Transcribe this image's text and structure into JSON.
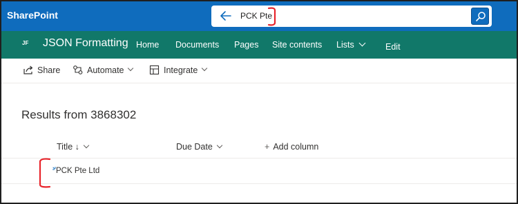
{
  "suite_bar": {
    "brand": "SharePoint",
    "search": {
      "query": "PCK Pte"
    }
  },
  "site_nav": {
    "avatar_initials": "JF",
    "site_title": "JSON Formatting",
    "items": [
      {
        "label": "Home"
      },
      {
        "label": "Documents"
      },
      {
        "label": "Pages"
      },
      {
        "label": "Site contents"
      },
      {
        "label": "Lists"
      },
      {
        "label": "Edit"
      }
    ]
  },
  "command_bar": {
    "share": "Share",
    "automate": "Automate",
    "integrate": "Integrate"
  },
  "results": {
    "title": "Results from 3868302",
    "columns": {
      "title": "Title",
      "sort_indicator": "↓",
      "due_date": "Due Date",
      "add_column": "Add column",
      "add_symbol": "+"
    },
    "rows": [
      {
        "title": "PCK Pte Ltd",
        "due_date": ""
      }
    ]
  },
  "colors": {
    "suite_bar": "#0f6cbd",
    "site_nav": "#117869",
    "annotation": "#e8242b"
  },
  "icons": [
    "back-arrow-icon",
    "search-icon",
    "share-icon",
    "automate-icon",
    "integrate-icon",
    "chevron-down-icon",
    "new-item-sparkle-icon"
  ]
}
